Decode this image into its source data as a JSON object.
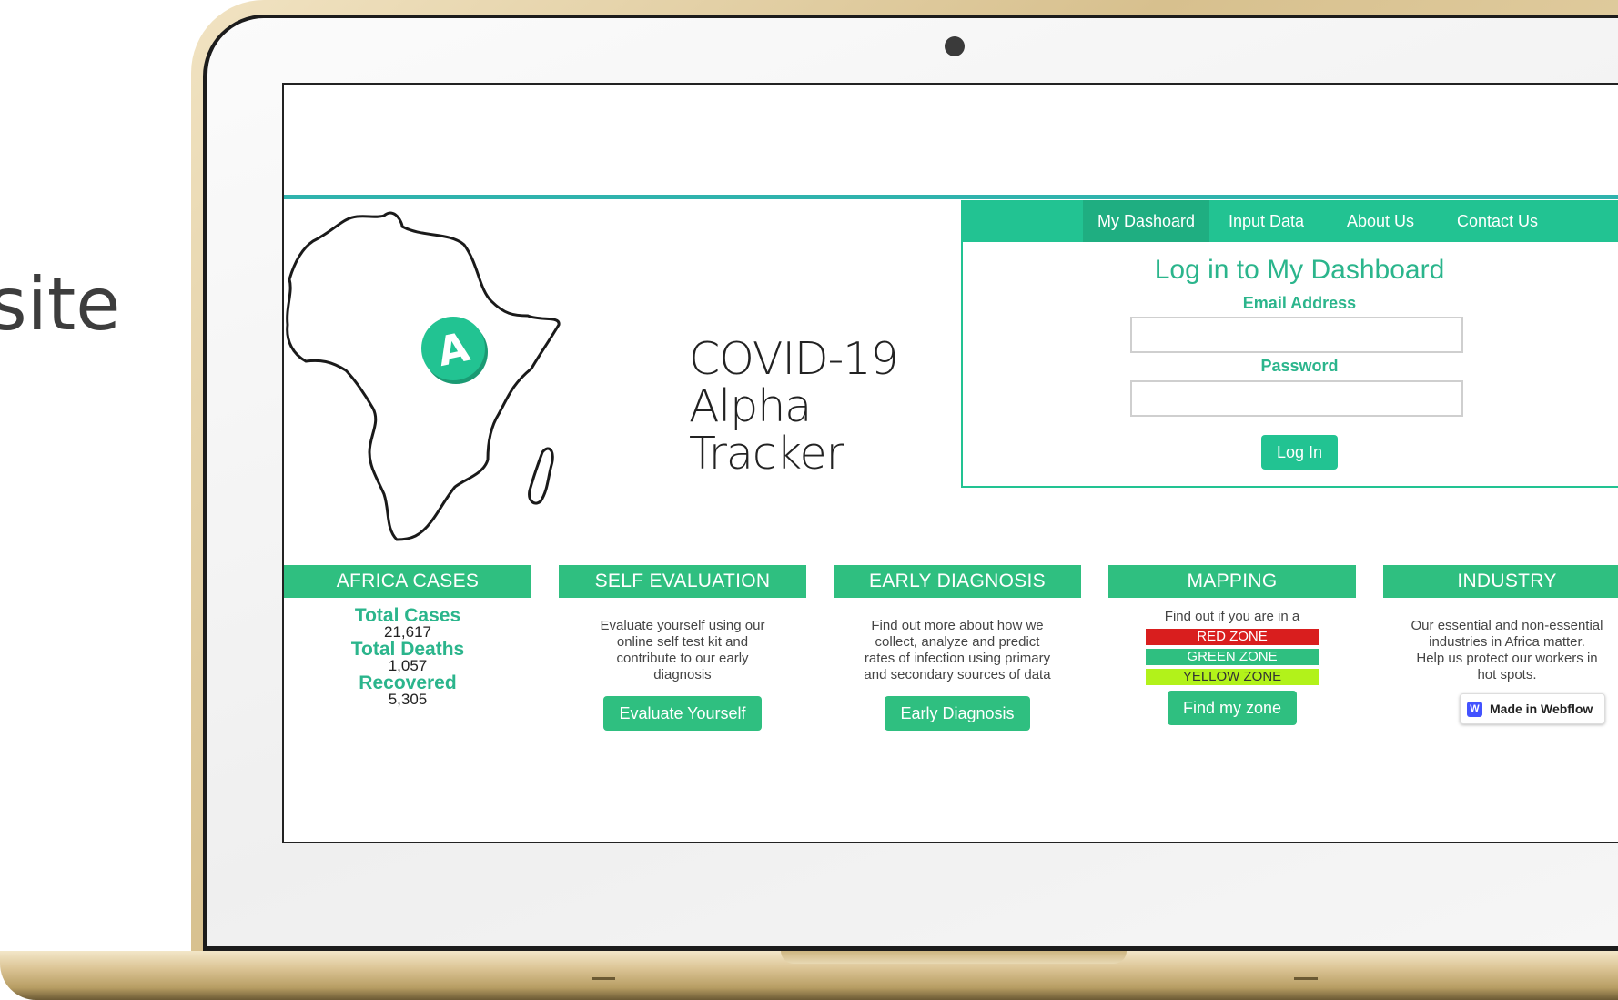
{
  "slide": {
    "text_fragment": "site"
  },
  "site": {
    "title_line1": "COVID-19",
    "title_line2": "Alpha Tracker",
    "logo_letter": "A",
    "nav": [
      {
        "label": "My Dashoard",
        "active": true
      },
      {
        "label": "Input Data"
      },
      {
        "label": "About Us"
      },
      {
        "label": "Contact Us"
      }
    ],
    "login": {
      "title": "Log in to My Dashboard",
      "email_label": "Email Address",
      "email_value": "",
      "password_label": "Password",
      "password_value": "",
      "button": "Log In"
    },
    "columns": {
      "cases": {
        "header": "AFRICA CASES",
        "total_cases_label": "Total Cases",
        "total_cases_value": "21,617",
        "total_deaths_label": "Total Deaths",
        "total_deaths_value": "1,057",
        "recovered_label": "Recovered",
        "recovered_value": "5,305"
      },
      "self_evaluation": {
        "header": "SELF EVALUATION",
        "lines": [
          "Evaluate yourself using our",
          "online self test kit and",
          "contribute to our early",
          "diagnosis"
        ],
        "button": "Evaluate Yourself"
      },
      "early_diagnosis": {
        "header": "EARLY DIAGNOSIS",
        "lines": [
          "Find out more about how we",
          "collect, analyze and predict",
          "rates of infection using primary",
          "and secondary sources of data"
        ],
        "button": "Early Diagnosis"
      },
      "mapping": {
        "header": "MAPPING",
        "intro": "Find out if you are in a",
        "zones": [
          {
            "label": "RED ZONE",
            "color": "#d91e1e"
          },
          {
            "label": "GREEN ZONE",
            "color": "#2fbf80"
          },
          {
            "label": "YELLOW ZONE",
            "color": "#b2f21a"
          }
        ],
        "button": "Find my zone"
      },
      "industry": {
        "header": "INDUSTRY",
        "lines": [
          "Our essential and non-essential",
          "industries in Africa matter.",
          "Help us protect our workers in",
          "hot spots."
        ]
      }
    },
    "webflow_badge": {
      "icon": "W",
      "label": "Made in Webflow"
    }
  },
  "colors": {
    "accent": "#22c392",
    "header_green": "#2fbf80",
    "teal_line": "#2fb3ad"
  }
}
